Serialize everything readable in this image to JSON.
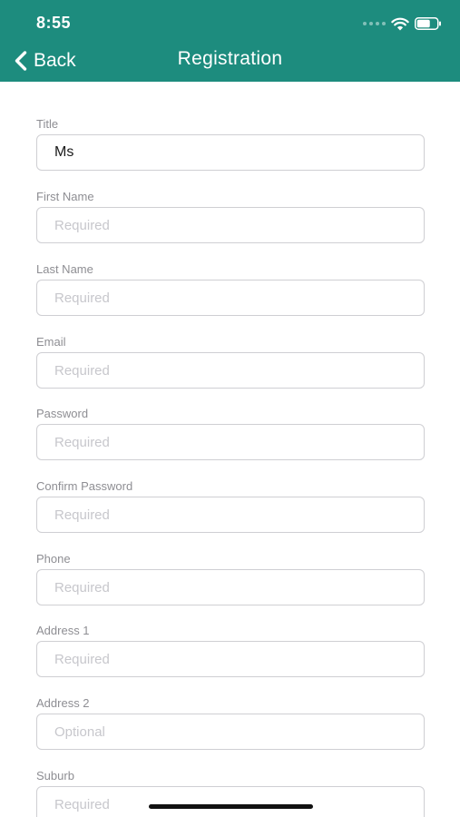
{
  "status_bar": {
    "time": "8:55"
  },
  "nav": {
    "back_label": "Back",
    "title": "Registration"
  },
  "colors": {
    "header": "#1d8c7e"
  },
  "icons": {
    "back": "chevron-left-icon",
    "wifi": "wifi-icon",
    "battery": "battery-icon",
    "signal": "signal-icon"
  },
  "form": {
    "fields": [
      {
        "label": "Title",
        "value": "Ms",
        "placeholder": ""
      },
      {
        "label": "First Name",
        "value": "",
        "placeholder": "Required"
      },
      {
        "label": "Last Name",
        "value": "",
        "placeholder": "Required"
      },
      {
        "label": "Email",
        "value": "",
        "placeholder": "Required"
      },
      {
        "label": "Password",
        "value": "",
        "placeholder": "Required"
      },
      {
        "label": "Confirm Password",
        "value": "",
        "placeholder": "Required"
      },
      {
        "label": "Phone",
        "value": "",
        "placeholder": "Required"
      },
      {
        "label": "Address 1",
        "value": "",
        "placeholder": "Required"
      },
      {
        "label": "Address 2",
        "value": "",
        "placeholder": "Optional"
      },
      {
        "label": "Suburb",
        "value": "",
        "placeholder": "Required"
      }
    ]
  }
}
